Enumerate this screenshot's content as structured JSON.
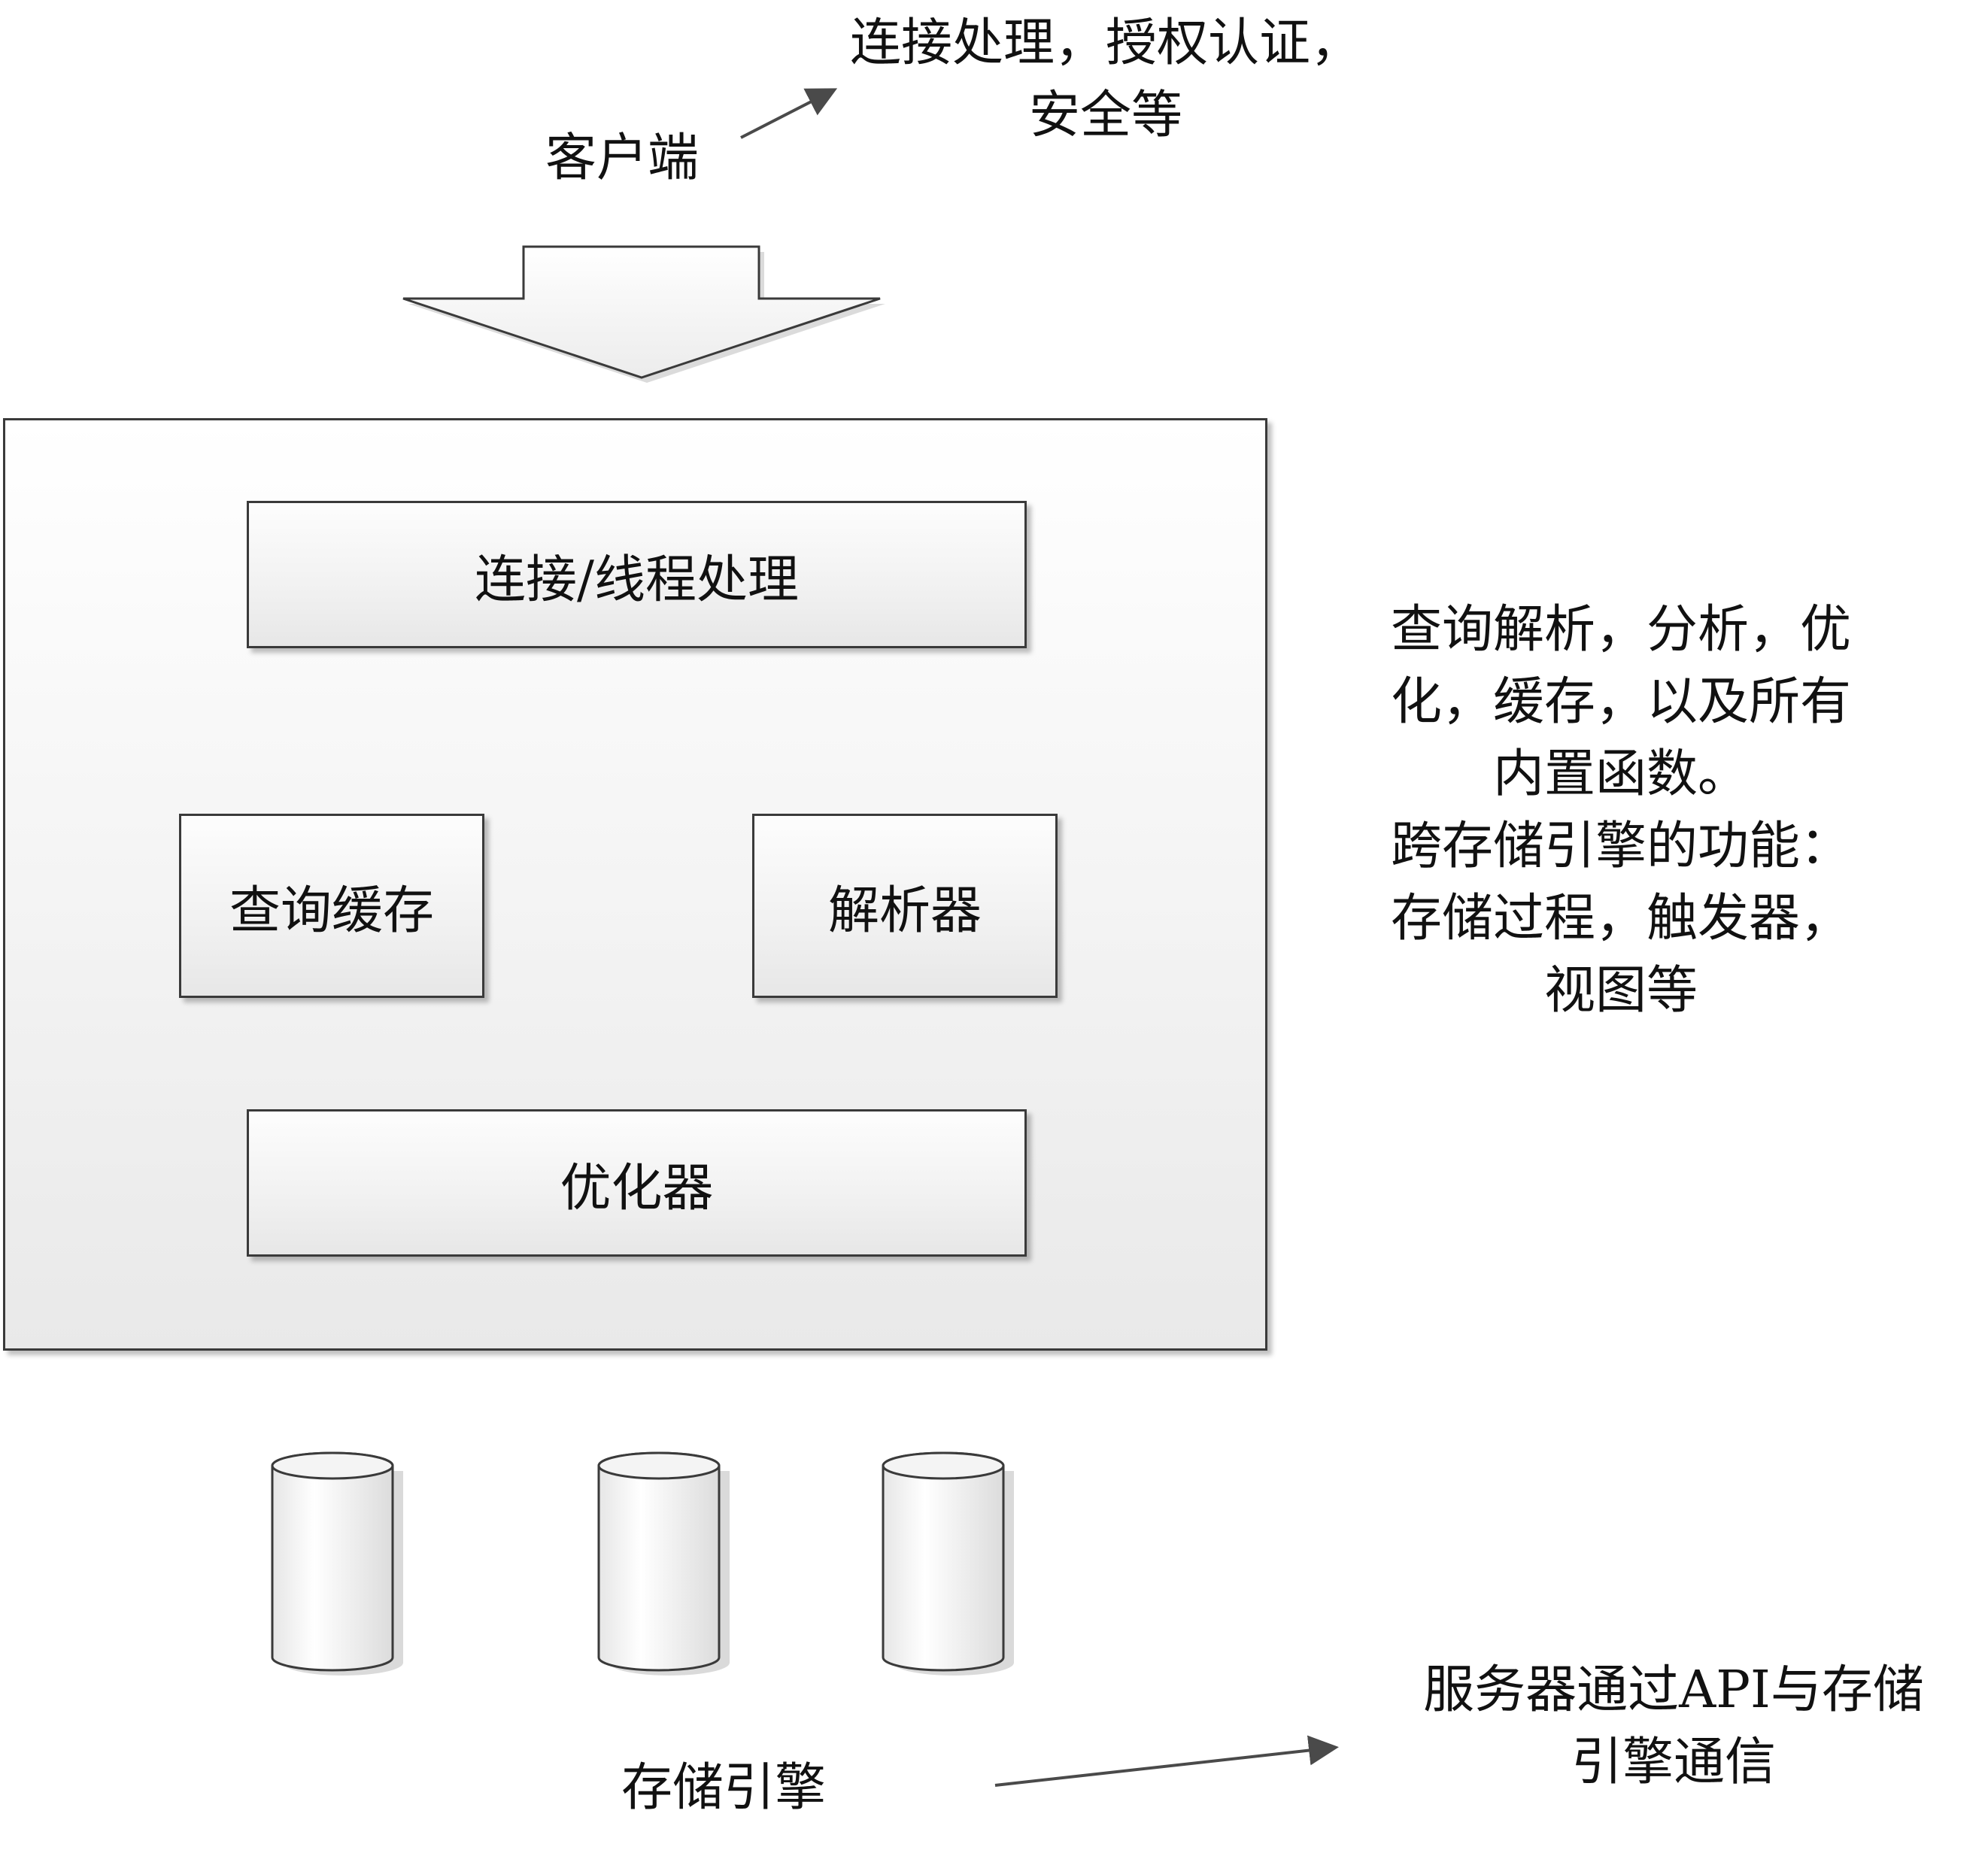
{
  "client": {
    "label": "客户端"
  },
  "client_note": {
    "lines": [
      "连接处理，授权认证，",
      "安全等"
    ]
  },
  "server": {
    "modules": {
      "connection": "连接/线程处理",
      "query_cache": "查询缓存",
      "parser": "解析器",
      "optimizer": "优化器"
    }
  },
  "server_note": {
    "lines": [
      "查询解析，分析，优",
      "化，缓存，以及所有",
      "内置函数。",
      "跨存储引擎的功能：",
      "存储过程，触发器，",
      "视图等"
    ]
  },
  "storage": {
    "label": "存储引擎"
  },
  "storage_note": {
    "lines": [
      "服务器通过API与存储",
      "引擎通信"
    ]
  }
}
